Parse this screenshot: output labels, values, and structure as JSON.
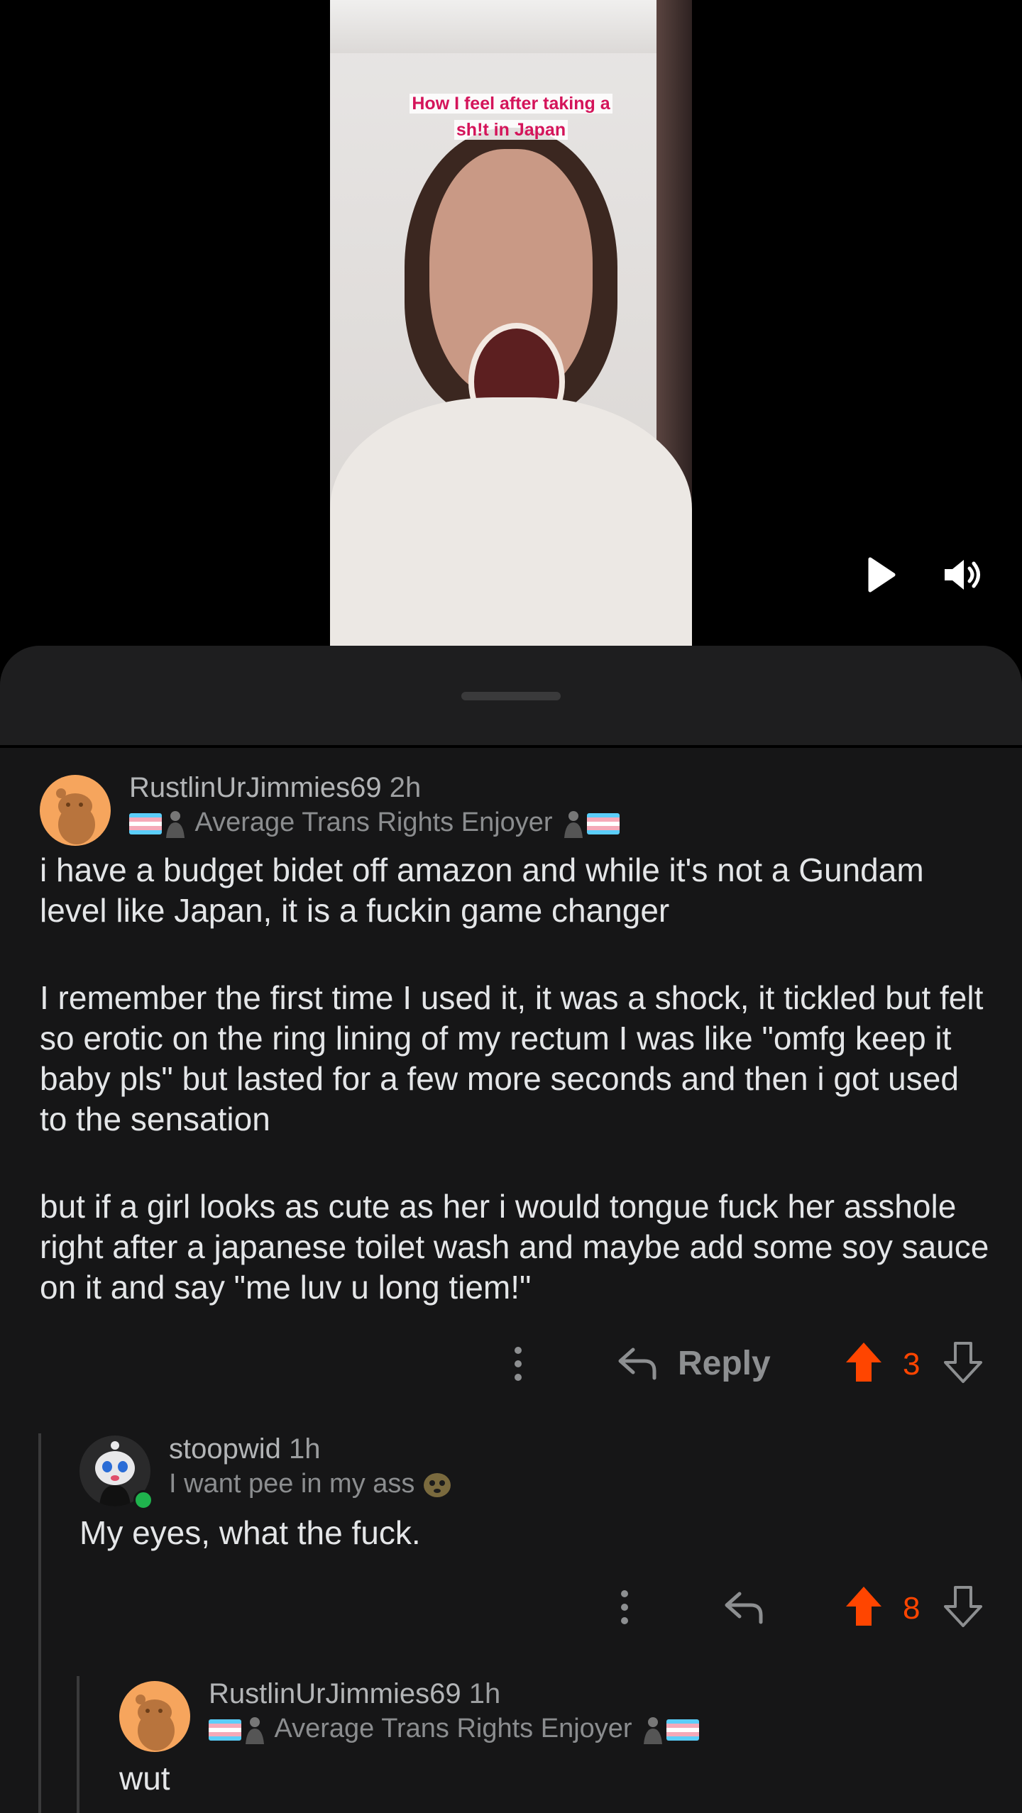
{
  "video": {
    "caption_line1": "How I feel after taking a",
    "caption_line2": "sh!t in Japan",
    "play_icon": "play-icon",
    "sound_icon": "volume-icon"
  },
  "comments": [
    {
      "username": "RustlinUrJimmies69",
      "age": "2h",
      "flair": "Average Trans Rights Enjoyer",
      "paragraphs": [
        "i have a budget bidet off amazon and while it's not a Gundam level like Japan, it is a fuckin game changer",
        "I remember the first time I used it, it was a shock, it tickled but felt so erotic on the ring lining of my rectum I was like \"omfg keep it baby pls\" but lasted for a few more seconds and then i got used to the sensation",
        "but if a girl looks as cute as her i would tongue fuck her asshole right after a japanese toilet wash and maybe add some soy sauce on it and say \"me luv u long tiem!\""
      ],
      "reply_label": "Reply",
      "score": "3"
    },
    {
      "username": "stoopwid",
      "age": "1h",
      "flair": "I want pee in my ass",
      "body": "My eyes, what the fuck.",
      "score": "8"
    },
    {
      "username": "RustlinUrJimmies69",
      "age": "1h",
      "flair": "Average Trans Rights Enjoyer",
      "body": "wut"
    }
  ],
  "colors": {
    "upvote": "#ff4500",
    "background": "#161617",
    "sheet_header": "#1e1e1f"
  }
}
